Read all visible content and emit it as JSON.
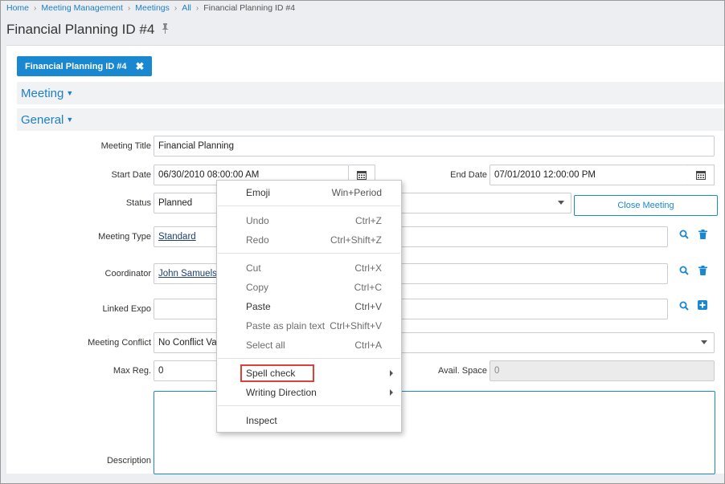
{
  "breadcrumb": {
    "items": [
      "Home",
      "Meeting Management",
      "Meetings",
      "All"
    ],
    "current": "Financial Planning ID #4"
  },
  "page": {
    "title": "Financial Planning ID #4"
  },
  "tab": {
    "label": "Financial Planning ID #4"
  },
  "sections": {
    "meeting": "Meeting",
    "general": "General"
  },
  "form": {
    "meeting_title_label": "Meeting Title",
    "meeting_title_value": "Financial Planning",
    "start_date_label": "Start Date",
    "start_date_value": "06/30/2010 08:00:00 AM",
    "end_date_label": "End Date",
    "end_date_value": "07/01/2010 12:00:00 PM",
    "status_label": "Status",
    "status_value": "Planned",
    "close_meeting_label": "Close Meeting",
    "meeting_type_label": "Meeting Type",
    "meeting_type_value": "Standard",
    "coordinator_label": "Coordinator",
    "coordinator_value": "John Samuels",
    "linked_expo_label": "Linked Expo",
    "meeting_conflict_label": "Meeting Conflict",
    "meeting_conflict_value": "No Conflict Val",
    "max_reg_label": "Max Reg.",
    "max_reg_value": "0",
    "avail_space_label": "Avail. Space",
    "avail_space_value": "0",
    "description_label": "Description"
  },
  "context_menu": {
    "emoji": {
      "label": "Emoji",
      "shortcut": "Win+Period"
    },
    "undo": {
      "label": "Undo",
      "shortcut": "Ctrl+Z"
    },
    "redo": {
      "label": "Redo",
      "shortcut": "Ctrl+Shift+Z"
    },
    "cut": {
      "label": "Cut",
      "shortcut": "Ctrl+X"
    },
    "copy": {
      "label": "Copy",
      "shortcut": "Ctrl+C"
    },
    "paste": {
      "label": "Paste",
      "shortcut": "Ctrl+V"
    },
    "paste_plain": {
      "label": "Paste as plain text",
      "shortcut": "Ctrl+Shift+V"
    },
    "select_all": {
      "label": "Select all",
      "shortcut": "Ctrl+A"
    },
    "spell_check": {
      "label": "Spell check"
    },
    "writing_direction": {
      "label": "Writing Direction"
    },
    "inspect": {
      "label": "Inspect"
    }
  },
  "colors": {
    "accent": "#1a88d0",
    "highlight": "#d9413a",
    "danger_icon": "#1a88d0"
  }
}
